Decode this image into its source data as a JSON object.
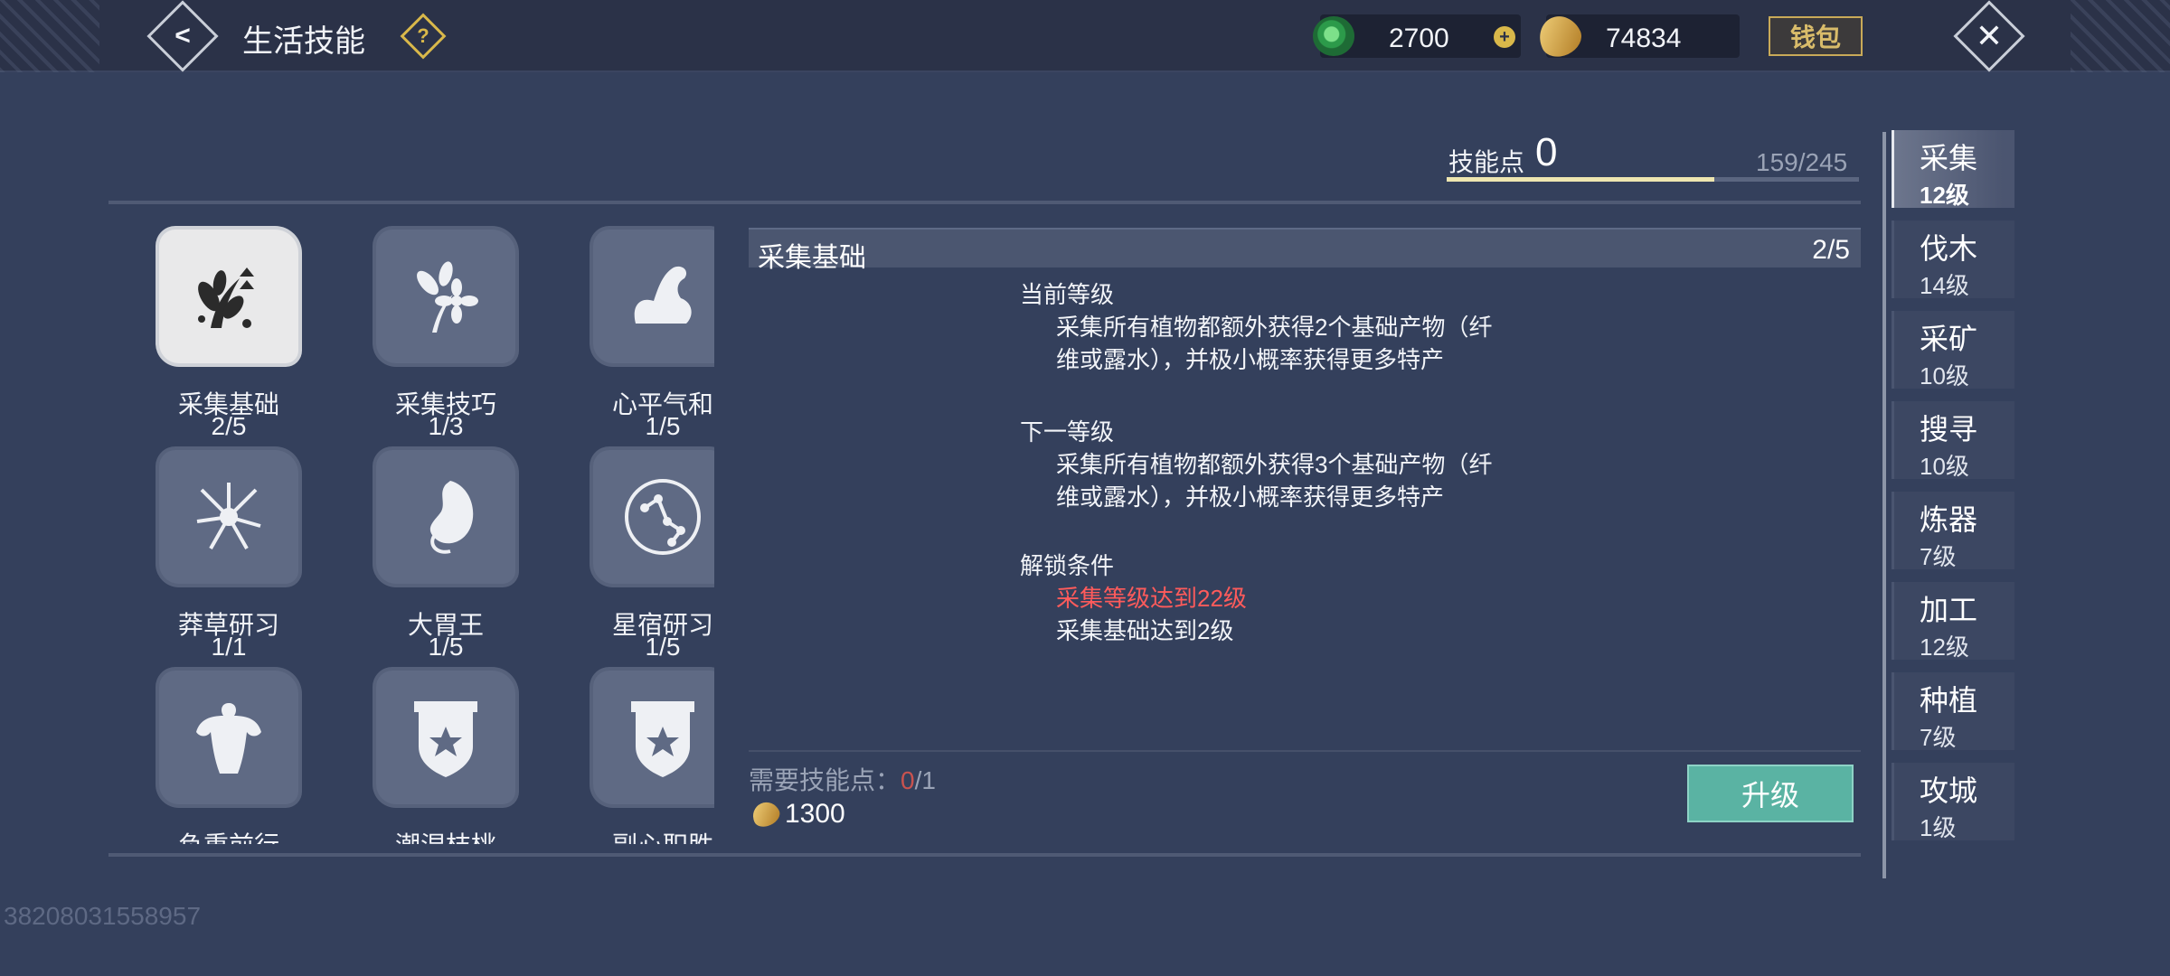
{
  "header": {
    "title": "生活技能",
    "help_icon": "?",
    "back_icon": "<",
    "currencies": [
      {
        "name": "jade",
        "icon": "jade-coin-icon",
        "value": "2700"
      },
      {
        "name": "gold",
        "icon": "gold-coin-icon",
        "value": "74834"
      }
    ],
    "plus_icon": "+",
    "wallet_label": "钱包",
    "close_icon": "✕"
  },
  "skill_points": {
    "label": "技能点",
    "value": "0",
    "progress_text": "159/245",
    "progress_fraction": 0.649
  },
  "skills": [
    {
      "name": "采集基础",
      "level": "2/5",
      "icon": "herb-leaves-icon",
      "selected": true
    },
    {
      "name": "采集技巧",
      "level": "1/3",
      "icon": "flower-sprig-icon",
      "selected": false
    },
    {
      "name": "心平气和",
      "level": "1/5",
      "icon": "flexed-arm-icon",
      "selected": false
    },
    {
      "name": "莽草研习",
      "level": "1/1",
      "icon": "spiky-plant-icon",
      "selected": false
    },
    {
      "name": "大胃王",
      "level": "1/5",
      "icon": "stomach-icon",
      "selected": false
    },
    {
      "name": "星宿研习",
      "level": "1/5",
      "icon": "constellation-icon",
      "selected": false
    },
    {
      "name": "负重前行",
      "level": "",
      "icon": "muscle-torso-icon",
      "selected": false
    },
    {
      "name": "潮湿枝桃",
      "level": "",
      "icon": "banner-star-icon",
      "selected": false
    },
    {
      "name": "副心职胜",
      "level": "",
      "icon": "banner-star-icon",
      "selected": false
    }
  ],
  "detail": {
    "title": "采集基础",
    "level": "2/5",
    "current_label": "当前等级",
    "current_text_1": "采集所有植物都额外获得2个基础产物（纤",
    "current_text_2": "维或露水），并极小概率获得更多特产",
    "next_label": "下一等级",
    "next_text_1": "采集所有植物都额外获得3个基础产物（纤",
    "next_text_2": "维或露水），并极小概率获得更多特产",
    "unlock_label": "解锁条件",
    "unlock_1": "采集等级达到22级",
    "unlock_1_color": "#ff5b5b",
    "unlock_2": "采集基础达到2级",
    "req_label": "需要技能点：",
    "req_have": "0",
    "req_need": "/1",
    "cost_value": "1300",
    "upgrade_label": "升级"
  },
  "tabs": [
    {
      "name": "采集",
      "level": "12级",
      "active": true
    },
    {
      "name": "伐木",
      "level": "14级",
      "active": false
    },
    {
      "name": "采矿",
      "level": "10级",
      "active": false
    },
    {
      "name": "搜寻",
      "level": "10级",
      "active": false
    },
    {
      "name": "炼器",
      "level": "7级",
      "active": false
    },
    {
      "name": "加工",
      "level": "12级",
      "active": false
    },
    {
      "name": "种植",
      "level": "7级",
      "active": false
    },
    {
      "name": "攻城",
      "level": "1级",
      "active": false
    }
  ],
  "uid": "38208031558957"
}
